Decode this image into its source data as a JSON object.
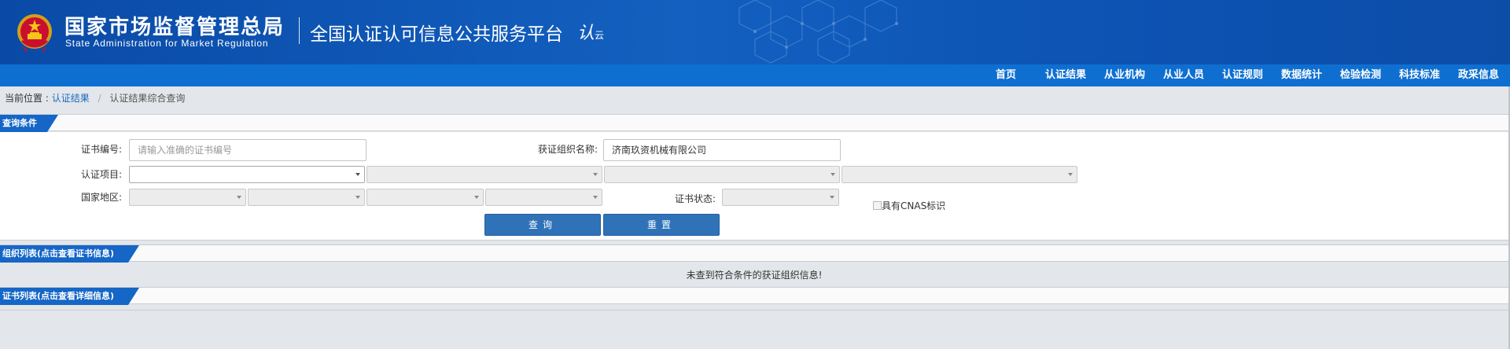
{
  "header": {
    "org_cn": "国家市场监督管理总局",
    "org_en": "State Administration  for  Market Regulation",
    "platform_title": "全国认证认可信息公共服务平台",
    "logo_text": "认",
    "logo_sub": "云"
  },
  "nav": {
    "items": [
      "首页",
      "认证结果",
      "从业机构",
      "从业人员",
      "认证规则",
      "数据统计",
      "检验检测",
      "科技标准",
      "政采信息"
    ]
  },
  "breadcrumb": {
    "prefix": "当前位置 :",
    "link": "认证结果",
    "separator": "/",
    "current": "认证结果综合查询"
  },
  "query": {
    "section_title": "查询条件",
    "cert_no_label": "证书编号:",
    "cert_no_placeholder": "请输入准确的证书编号",
    "org_name_label": "获证组织名称:",
    "org_name_value": "济南玖资机械有限公司",
    "cert_item_label": "认证项目:",
    "region_label": "国家地区:",
    "cert_status_label": "证书状态:",
    "cnas_label": "具有CNAS标识",
    "search_button": "查询",
    "reset_button": "重置"
  },
  "org_list": {
    "section_title": "组织列表(点击查看证书信息)",
    "empty_message": "未查到符合条件的获证组织信息!"
  },
  "cert_list": {
    "section_title": "证书列表(点击查看详细信息)"
  },
  "colors": {
    "banner": "#0d54b4",
    "nav": "#0f6fd1",
    "section_tab": "#1566c6",
    "button": "#2f72b8",
    "link": "#1a6bc4"
  }
}
